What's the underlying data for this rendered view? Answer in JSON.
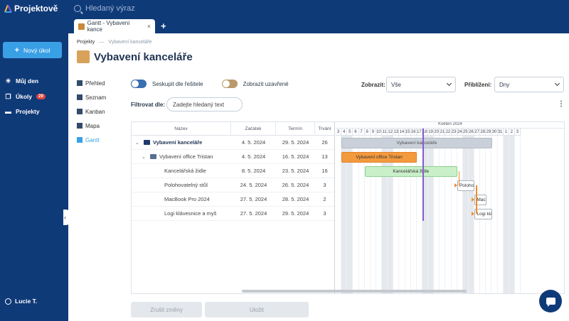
{
  "app": {
    "name": "Projektově",
    "search_placeholder": "Hledaný výraz"
  },
  "tabs": [
    {
      "label": "Gantt - Vybavení kance",
      "close": "×"
    }
  ],
  "tab_add": "+",
  "sidebar": {
    "new_task": "Nový úkol",
    "items": [
      {
        "label": "Můj den"
      },
      {
        "label": "Úkoly",
        "badge": "29"
      },
      {
        "label": "Projekty"
      }
    ],
    "user": "Lucie T."
  },
  "breadcrumb": {
    "root": "Projekty",
    "current": "Vybavení kanceláře"
  },
  "page_title": "Vybavení kanceláře",
  "views": [
    "Přehled",
    "Seznam",
    "Kanban",
    "Mapa",
    "Gantt"
  ],
  "toggles": {
    "group_by": "Seskupit dle řešitele",
    "show_closed": "Zobrazit uzavřené"
  },
  "display": {
    "label": "Zobrazit:",
    "value": "Vše"
  },
  "zoom": {
    "label": "Přiblížení:",
    "value": "Dny"
  },
  "filter": {
    "label": "Filtrovat dle:",
    "placeholder": "Zadejte hledaný text"
  },
  "kebab": "⋮",
  "table": {
    "headers": {
      "name": "Název",
      "start": "Začátek",
      "end": "Termín",
      "dur": "Trvání"
    },
    "rows": [
      {
        "name": "Vybavení kanceláře",
        "start": "4. 5. 2024",
        "end": "29. 5. 2024",
        "dur": "26"
      },
      {
        "name": "Vybavení office Tristan",
        "start": "4. 5. 2024",
        "end": "16. 5. 2024",
        "dur": "13"
      },
      {
        "name": "Kancelářská židle",
        "start": "8. 5. 2024",
        "end": "23. 5. 2024",
        "dur": "16"
      },
      {
        "name": "Polohovatelný stůl",
        "start": "24. 5. 2024",
        "end": "26. 5. 2024",
        "dur": "3"
      },
      {
        "name": "MacBook Pro 2024",
        "start": "27. 5. 2024",
        "end": "28. 5. 2024",
        "dur": "2"
      },
      {
        "name": "Logi klávesnice a myš",
        "start": "27. 5. 2024",
        "end": "29. 5. 2024",
        "dur": "3"
      }
    ]
  },
  "timeline": {
    "month": "Květen 2024",
    "days": [
      "3",
      "4",
      "5",
      "6",
      "7",
      "8",
      "9",
      "10",
      "11",
      "12",
      "13",
      "14",
      "15",
      "16",
      "17",
      "18",
      "19",
      "20",
      "21",
      "22",
      "23",
      "24",
      "25",
      "26",
      "27",
      "28",
      "29",
      "30",
      "31",
      "1",
      "2",
      "3"
    ],
    "bars": [
      {
        "label": "Vybavení kanceláře",
        "start_day": "4",
        "end_day": "29",
        "color": "#c9d0d9",
        "text_color": "#555"
      },
      {
        "label": "Vybavení office Tristan",
        "start_day": "4",
        "end_day": "16",
        "color": "#f39a3d",
        "text_color": "#333"
      },
      {
        "label": "Kancelářská židle",
        "start_day": "8",
        "end_day": "23",
        "color": "#c9f0c9",
        "text_color": "#333"
      },
      {
        "label": "Polohovatel",
        "start_day": "24",
        "end_day": "26",
        "color": "#ffffff",
        "text_color": "#333"
      },
      {
        "label": "MacBo",
        "start_day": "27",
        "end_day": "28",
        "color": "#ffffff",
        "text_color": "#333"
      },
      {
        "label": "Logi kláve",
        "start_day": "27",
        "end_day": "29",
        "color": "#ffffff",
        "text_color": "#333"
      }
    ]
  },
  "buttons": {
    "cancel": "Zrušit změny",
    "save": "Uložit"
  }
}
